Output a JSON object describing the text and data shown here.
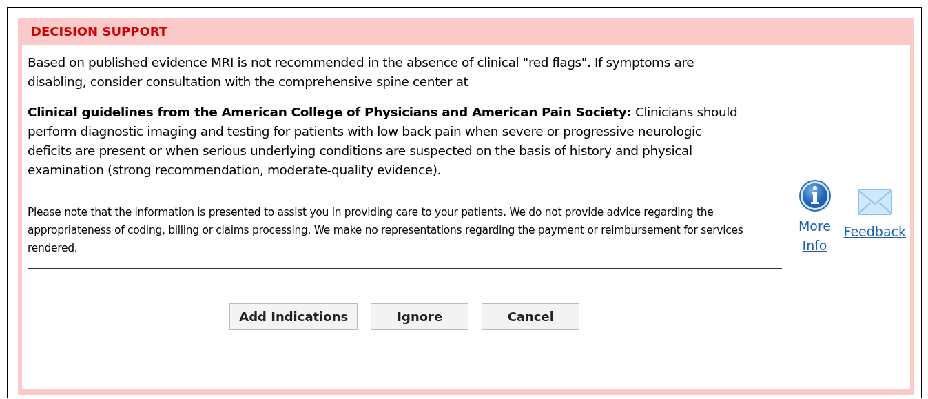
{
  "panel": {
    "title": "DECISION SUPPORT"
  },
  "paragraphs": [
    {
      "kind": "body",
      "text": "Based on published evidence MRI is not recommended in the absence of clinical \"red flags\". If symptoms are disabling, consider consultation with the comprehensive spine center at"
    },
    {
      "kind": "body",
      "text": "**Clinical guidelines from the American College of Physicians and American Pain Society:** Clinicians should perform diagnostic imaging and testing for patients with low back pain when severe or progressive neurologic deficits are present or when serious underlying conditions are suspected on the basis of history and physical examination (strong recommendation, moderate-quality evidence)."
    },
    {
      "kind": "note",
      "text": "Please note that the information is presented to assist you in providing care to your patients. We do not provide advice regarding the appropriateness of coding, billing or claims processing. We make no representations regarding the payment or reimbursement for services rendered."
    }
  ],
  "links": [
    {
      "kind": "info",
      "label": "More Info"
    },
    {
      "kind": "mail",
      "label": "Feedback"
    }
  ],
  "buttons": [
    "Add Indications",
    "Ignore",
    "Cancel"
  ]
}
